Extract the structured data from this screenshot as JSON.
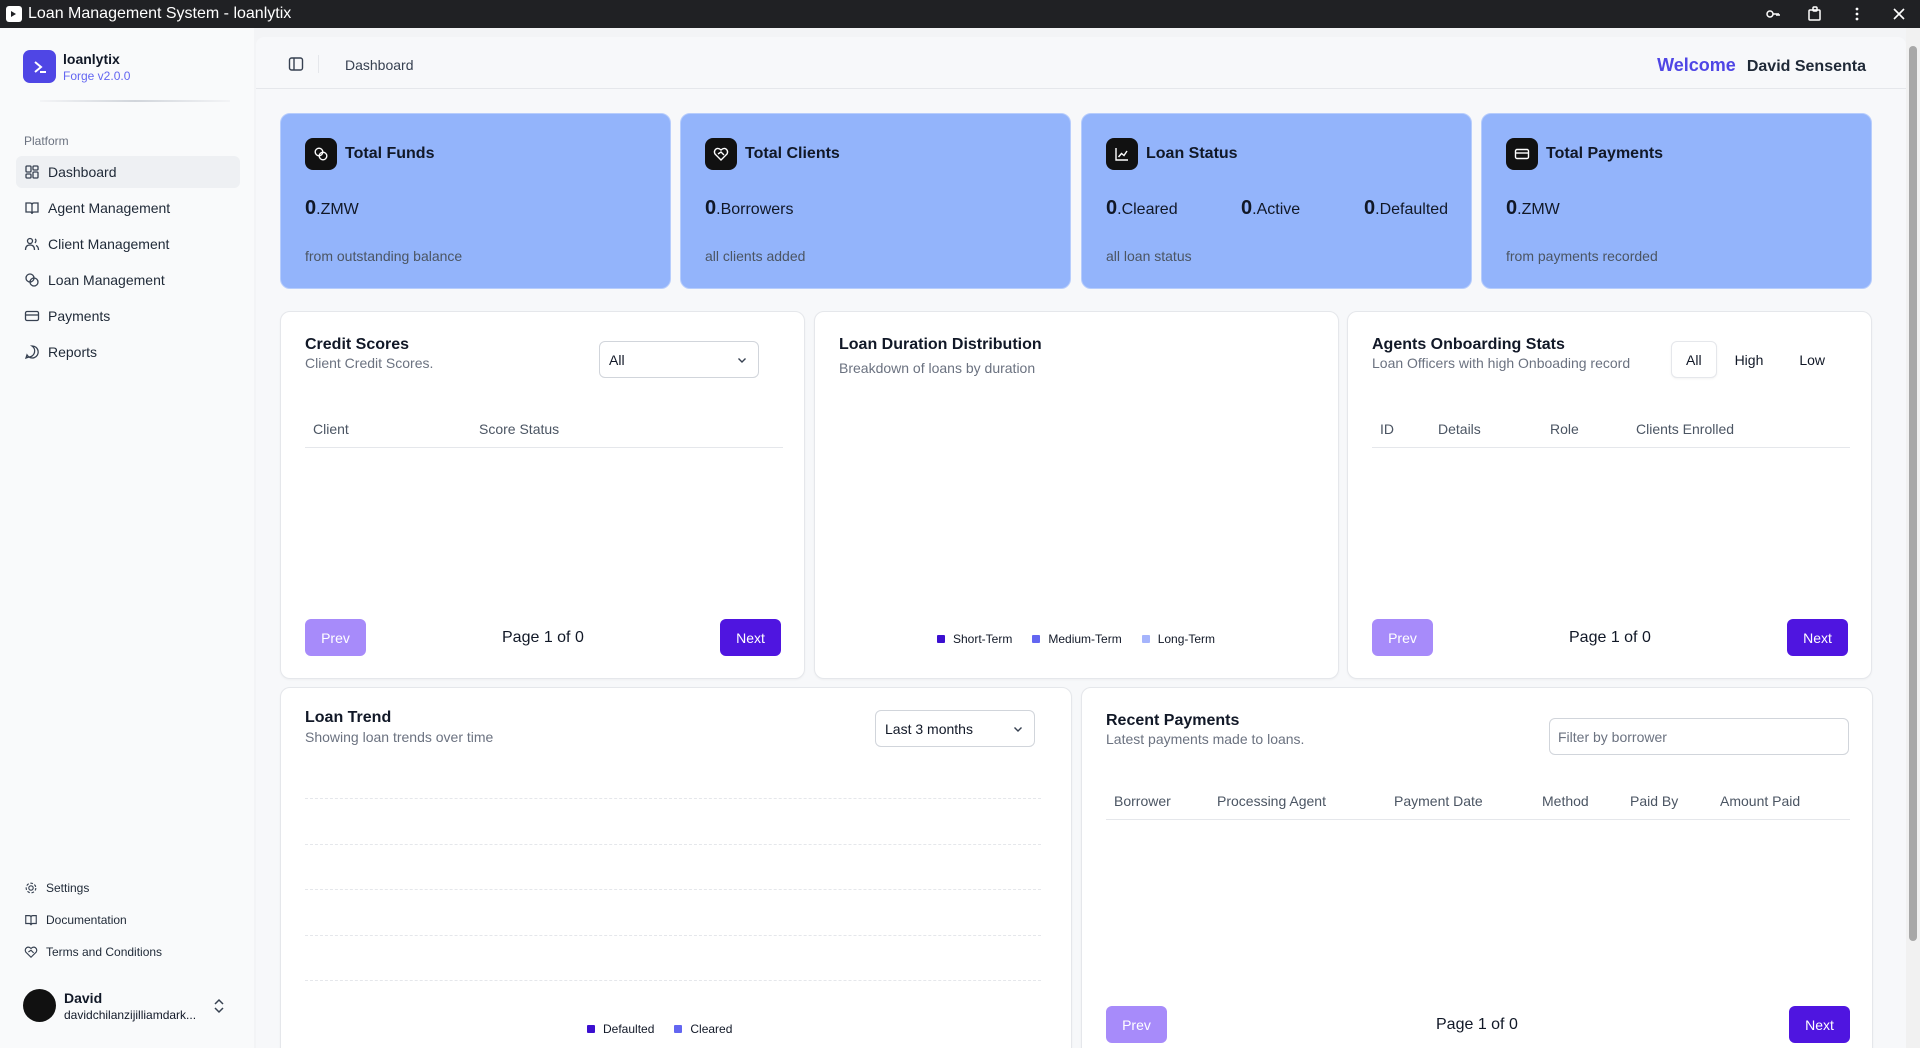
{
  "window": {
    "title": "Loan Management System - loanlytix"
  },
  "brand": {
    "name": "loanlytix",
    "version": "Forge v2.0.0"
  },
  "sidebar": {
    "section": "Platform",
    "items": [
      {
        "label": "Dashboard",
        "icon": "dashboard-icon",
        "active": true
      },
      {
        "label": "Agent Management",
        "icon": "book-icon"
      },
      {
        "label": "Client Management",
        "icon": "users-icon"
      },
      {
        "label": "Loan Management",
        "icon": "coins-icon"
      },
      {
        "label": "Payments",
        "icon": "credit-card-icon"
      },
      {
        "label": "Reports",
        "icon": "message-icon"
      }
    ],
    "bottom": [
      {
        "label": "Settings",
        "icon": "gear-icon"
      },
      {
        "label": "Documentation",
        "icon": "book-open-icon"
      },
      {
        "label": "Terms and Conditions",
        "icon": "handshake-icon"
      }
    ]
  },
  "user": {
    "name": "David",
    "email": "davidchilanzijilliamdark..."
  },
  "header": {
    "breadcrumb": "Dashboard",
    "welcome": "Welcome",
    "username": "David Sensenta"
  },
  "stats": {
    "funds": {
      "title": "Total Funds",
      "value": "0",
      "unit": ".ZMW",
      "sub": "from outstanding balance"
    },
    "clients": {
      "title": "Total Clients",
      "value": "0",
      "unit": ".Borrowers",
      "sub": "all clients added"
    },
    "loan_status": {
      "title": "Loan Status",
      "cleared": "0",
      "cleared_unit": ".Cleared",
      "active": "0",
      "active_unit": ".Active",
      "defaulted": "0",
      "defaulted_unit": ".Defaulted",
      "sub": "all loan status"
    },
    "payments": {
      "title": "Total Payments",
      "value": "0",
      "unit": ".ZMW",
      "sub": "from payments recorded"
    }
  },
  "credit_scores": {
    "title": "Credit Scores",
    "subtitle": "Client Credit Scores.",
    "filter": "All",
    "columns": [
      "Client",
      "Score Status"
    ],
    "prev": "Prev",
    "next": "Next",
    "page": "Page 1 of 0"
  },
  "duration": {
    "title": "Loan Duration Distribution",
    "subtitle": "Breakdown of loans by duration",
    "legend": [
      {
        "label": "Short-Term",
        "color": "#3b0fd0"
      },
      {
        "label": "Medium-Term",
        "color": "#6366f1"
      },
      {
        "label": "Long-Term",
        "color": "#a5b4fc"
      }
    ]
  },
  "agents": {
    "title": "Agents Onboarding Stats",
    "subtitle": "Loan Officers with high Onboading record",
    "tabs": [
      "All",
      "High",
      "Low"
    ],
    "columns": [
      "ID",
      "Details",
      "Role",
      "Clients Enrolled"
    ],
    "prev": "Prev",
    "next": "Next",
    "page": "Page 1 of 0"
  },
  "trend": {
    "title": "Loan Trend",
    "subtitle": "Showing loan trends over time",
    "range": "Last 3 months",
    "legend": [
      {
        "label": "Defaulted",
        "color": "#3b0fd0"
      },
      {
        "label": "Cleared",
        "color": "#6366f1"
      }
    ]
  },
  "recent": {
    "title": "Recent Payments",
    "subtitle": "Latest payments made to loans.",
    "filter_placeholder": "Filter by borrower",
    "columns": [
      "Borrower",
      "Processing Agent",
      "Payment Date",
      "Method",
      "Paid By",
      "Amount Paid"
    ],
    "prev": "Prev",
    "next": "Next",
    "page": "Page 1 of 0"
  },
  "colors": {
    "accent": "#4f15e0",
    "brand": "#4f46e5",
    "stat_card": "#93b4fb",
    "prev_disabled": "#a78bfa"
  }
}
